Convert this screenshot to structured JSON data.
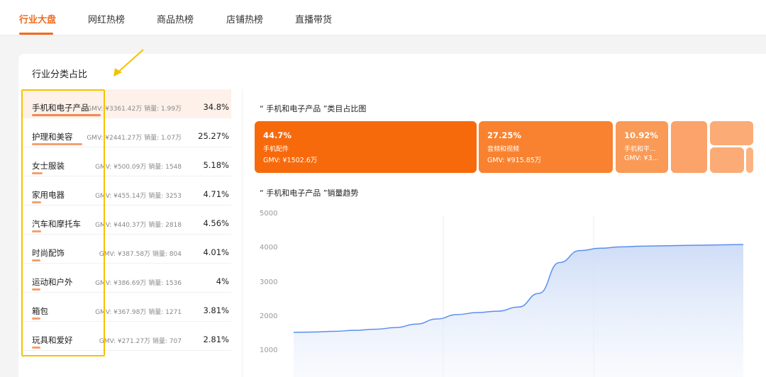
{
  "nav": {
    "tabs": [
      {
        "label": "行业大盘",
        "active": true
      },
      {
        "label": "网红热榜",
        "active": false
      },
      {
        "label": "商品热榜",
        "active": false
      },
      {
        "label": "店铺热榜",
        "active": false
      },
      {
        "label": "直播带货",
        "active": false
      }
    ]
  },
  "panel": {
    "title": "行业分类占比"
  },
  "categories": [
    {
      "name": "手机和电子产品",
      "gmv": "GMV: ¥3361.42万",
      "sales": "销量: 1.99万",
      "pct": "34.8%",
      "share": 0.348
    },
    {
      "name": "护理和美容",
      "gmv": "GMV: ¥2441.27万",
      "sales": "销量: 1.07万",
      "pct": "25.27%",
      "share": 0.2527
    },
    {
      "name": "女士服装",
      "gmv": "GMV: ¥500.09万",
      "sales": "销量: 1548",
      "pct": "5.18%",
      "share": 0.0518
    },
    {
      "name": "家用电器",
      "gmv": "GMV: ¥455.14万",
      "sales": "销量: 3253",
      "pct": "4.71%",
      "share": 0.0471
    },
    {
      "name": "汽车和摩托车",
      "gmv": "GMV: ¥440.37万",
      "sales": "销量: 2818",
      "pct": "4.56%",
      "share": 0.0456
    },
    {
      "name": "时尚配饰",
      "gmv": "GMV: ¥387.58万",
      "sales": "销量: 804",
      "pct": "4.01%",
      "share": 0.0401
    },
    {
      "name": "运动和户外",
      "gmv": "GMV: ¥386.69万",
      "sales": "销量: 1536",
      "pct": "4%",
      "share": 0.04
    },
    {
      "name": "箱包",
      "gmv": "GMV: ¥367.98万",
      "sales": "销量: 1271",
      "pct": "3.81%",
      "share": 0.0381
    },
    {
      "name": "玩具和爱好",
      "gmv": "GMV: ¥271.27万",
      "sales": "销量: 707",
      "pct": "2.81%",
      "share": 0.0281
    }
  ],
  "treemap": {
    "title": "“ 手机和电子产品 ”类目占比图",
    "tiles": [
      {
        "pct": "44.7%",
        "name": "手机配件",
        "gmv": "GMV: ¥1502.6万",
        "color": "#f76a0c"
      },
      {
        "pct": "27.25%",
        "name": "音频和视频",
        "gmv": "GMV: ¥915.85万",
        "color": "#f8822f"
      },
      {
        "pct": "10.92%",
        "name": "手机和平...",
        "gmv": "GMV: ¥3...",
        "color": "#f99a57"
      },
      {
        "pct": "",
        "name": "",
        "gmv": "",
        "color": "#fba36a"
      },
      {
        "pct": "",
        "name": "",
        "gmv": "",
        "color": "#fbab76"
      },
      {
        "pct": "",
        "name": "",
        "gmv": "",
        "color": "#fbab76"
      },
      {
        "pct": "",
        "name": "",
        "gmv": "",
        "color": "#fbb382"
      }
    ]
  },
  "trend": {
    "title": "“ 手机和电子产品 ”销量趋势",
    "chart_data": {
      "type": "area",
      "title": "“ 手机和电子产品 ”销量趋势",
      "y_ticks": [
        5000,
        4000,
        3000,
        2000,
        1000
      ],
      "ylim": [
        1000,
        5000
      ],
      "grid": true,
      "series": [
        {
          "values": [
            1560,
            1570,
            1590,
            1620,
            1650,
            1700,
            1800,
            1950,
            2080,
            2140,
            2180,
            2300,
            2700,
            3600,
            3950,
            4020,
            4060,
            4080,
            4090,
            4100,
            4110,
            4120,
            4130
          ]
        }
      ]
    }
  }
}
